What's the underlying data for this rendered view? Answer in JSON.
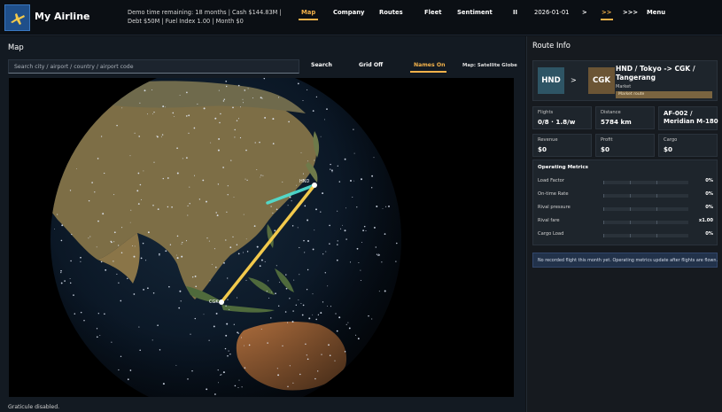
{
  "app": {
    "title": "My Airline",
    "logo_icon": "airplane-icon",
    "status_line1": "Demo time remaining: 18 months  |  Cash $144.83M  |",
    "status_line2": "Debt $50M  |  Fuel Index 1.00  |  Month $0"
  },
  "nav": {
    "tabs": [
      {
        "label": "Map",
        "active": true
      },
      {
        "label": "Company",
        "active": false
      },
      {
        "label": "Routes",
        "active": false
      },
      {
        "label": "Fleet",
        "active": false
      },
      {
        "label": "Sentiment",
        "active": false
      }
    ]
  },
  "time_controls": {
    "pause_label": "II",
    "date": "2026-01-01",
    "speed_1": ">",
    "speed_2": ">>",
    "speed_3": ">>>",
    "menu_label": "Menu",
    "active_speed": ">>"
  },
  "map": {
    "panel_title": "Map",
    "search_placeholder": "Search city / airport / country / airport code",
    "search_value": "",
    "search_button": "Search",
    "grid_button": "Grid Off",
    "names_button": "Names On",
    "mode_label": "Map: Satellite Globe",
    "status_text": "Graticule disabled.",
    "route_labels": {
      "origin": "HND",
      "destination": "CGK"
    },
    "colors": {
      "route_selected": "#f2c94c",
      "route_secondary": "#4fe3d6",
      "land": "#7a6a44",
      "ocean": "#0b1420"
    }
  },
  "route_info": {
    "panel_title": "Route Info",
    "from_code": "HND",
    "to_code": "CGK",
    "arrow": ">",
    "title": "HND / Tokyo -> CGK / Tangerang",
    "type_label": "Market",
    "badge": "Market route",
    "stats": [
      {
        "label": "Flights",
        "value": "0/8 · 1.8/w"
      },
      {
        "label": "Distance",
        "value": "5784 km"
      },
      {
        "label": "",
        "value": "AF-002 / Meridian M-180"
      },
      {
        "label": "Revenue",
        "value": "$0"
      },
      {
        "label": "Profit",
        "value": "$0"
      },
      {
        "label": "Cargo",
        "value": "$0"
      }
    ],
    "metrics_title": "Operating Metrics",
    "metrics": [
      {
        "label": "Load Factor",
        "value": "0%",
        "fill": 0
      },
      {
        "label": "On-time Rate",
        "value": "0%",
        "fill": 0
      },
      {
        "label": "Rival pressure",
        "value": "0%",
        "fill": 0
      },
      {
        "label": "Rival fare",
        "value": "x1.00",
        "fill": 0
      },
      {
        "label": "Cargo Load",
        "value": "0%",
        "fill": 0
      }
    ],
    "note": "No recorded flight this month yet. Operating metrics update after flights are flown."
  }
}
